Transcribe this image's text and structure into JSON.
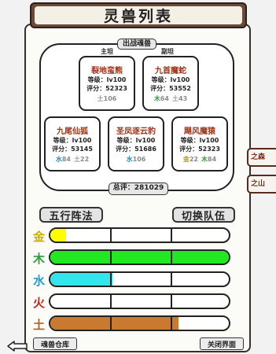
{
  "title": "灵兽列表",
  "lineup": {
    "battle_label": "出战魂兽",
    "main_tank_label": "主坦",
    "sub_tank_label": "副坦",
    "total_score": "总评：281029"
  },
  "beasts": [
    {
      "name": "裂地蛮熊",
      "level": "等级：lv100",
      "score": "评分：52323",
      "elements": [
        {
          "key": "earth",
          "glyph": "土",
          "value": "106"
        }
      ]
    },
    {
      "name": "九首魔蛇",
      "level": "等级：lv100",
      "score": "评分：53552",
      "elements": [
        {
          "key": "wood",
          "glyph": "木",
          "value": "64"
        },
        {
          "key": "earth",
          "glyph": "土",
          "value": "43"
        }
      ]
    },
    {
      "name": "九尾仙狐",
      "level": "等级：lv100",
      "score": "评分：53145",
      "elements": [
        {
          "key": "water",
          "glyph": "水",
          "value": "84"
        },
        {
          "key": "earth",
          "glyph": "土",
          "value": "22"
        }
      ]
    },
    {
      "name": "圣凤逐云豹",
      "level": "等级：lv100",
      "score": "评分：51686",
      "elements": [
        {
          "key": "water",
          "glyph": "水",
          "value": "106"
        }
      ]
    },
    {
      "name": "飓风魔猿",
      "level": "等级：lv100",
      "score": "评分：52323",
      "elements": [
        {
          "key": "gold",
          "glyph": "金",
          "value": "22"
        },
        {
          "key": "wood",
          "glyph": "木",
          "value": "84"
        }
      ]
    }
  ],
  "sections": {
    "formation": "五行阵法",
    "switch_team": "切换队伍"
  },
  "side_tabs": [
    "之森",
    "之山"
  ],
  "five_elements": [
    {
      "glyph": "金",
      "color": "#c9b000",
      "fill": "#ffff00",
      "level": 0.09,
      "partial_only": true
    },
    {
      "glyph": "木",
      "color": "#2e9c3c",
      "fill": "#22e822",
      "level": 1.0
    },
    {
      "glyph": "水",
      "color": "#1f9fd0",
      "fill": "#33e6ee",
      "level": 0.35
    },
    {
      "glyph": "火",
      "color": "#c02a1a",
      "fill": "#ff4a2a",
      "level": 0.0
    },
    {
      "glyph": "土",
      "color": "#b4601c",
      "fill": "#c97a30",
      "level": 0.72
    }
  ],
  "bottom": {
    "storage": "魂兽仓库",
    "close": "关闭界面"
  }
}
